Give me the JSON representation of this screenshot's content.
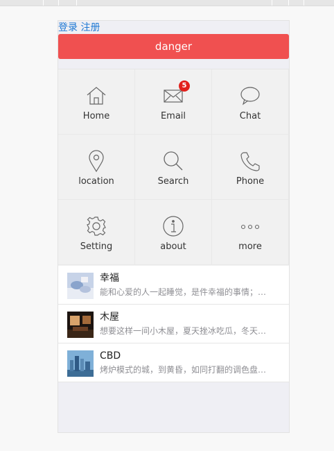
{
  "auth": {
    "login": "登录",
    "register": "注册"
  },
  "danger_button": {
    "label": "danger",
    "color": "#f05050"
  },
  "grid": {
    "items": [
      {
        "label": "Home",
        "icon": "home-icon"
      },
      {
        "label": "Email",
        "icon": "email-icon",
        "badge": "5"
      },
      {
        "label": "Chat",
        "icon": "chat-icon"
      },
      {
        "label": "location",
        "icon": "location-icon"
      },
      {
        "label": "Search",
        "icon": "search-icon"
      },
      {
        "label": "Phone",
        "icon": "phone-icon"
      },
      {
        "label": "Setting",
        "icon": "gear-icon"
      },
      {
        "label": "about",
        "icon": "info-icon"
      },
      {
        "label": "more",
        "icon": "more-icon"
      }
    ]
  },
  "list": {
    "items": [
      {
        "title": "幸福",
        "desc": "能和心爱的人一起睡觉，是件幸福的事情；可是，打呼噜怎么办？"
      },
      {
        "title": "木屋",
        "desc": "想要这样一间小木屋，夏天挫冰吃瓜，冬天围炉取暖。"
      },
      {
        "title": "CBD",
        "desc": "烤炉模式的城，到黄昏，如同打翻的调色盘一般。"
      }
    ]
  },
  "colors": {
    "link": "#1e78d4",
    "badge": "#e2211c"
  }
}
